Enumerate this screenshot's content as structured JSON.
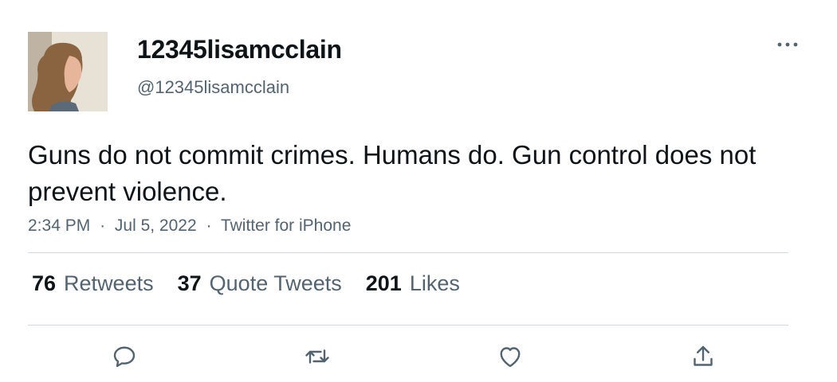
{
  "author": {
    "display_name": "12345lisamcclain",
    "handle": "@12345lisamcclain"
  },
  "tweet": {
    "text": "Guns do not commit crimes. Humans do. Gun control does not prevent violence.",
    "time": "2:34 PM",
    "date": "Jul 5, 2022",
    "separator": "·",
    "source": "Twitter for iPhone"
  },
  "stats": {
    "retweets": {
      "count": "76",
      "label": "Retweets"
    },
    "quote_tweets": {
      "count": "37",
      "label": "Quote Tweets"
    },
    "likes": {
      "count": "201",
      "label": "Likes"
    }
  },
  "icons": {
    "more": "more-icon",
    "reply": "reply-icon",
    "retweet": "retweet-icon",
    "like": "like-icon",
    "share": "share-icon"
  },
  "colors": {
    "text_primary": "#0f1419",
    "text_secondary": "#536471",
    "divider": "#cfd9de"
  }
}
